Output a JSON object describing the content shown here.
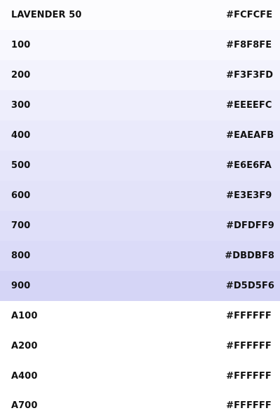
{
  "palette": {
    "swatches": [
      {
        "name": "LAVENDER 50",
        "hex": "#FCFCFE",
        "color": "#FCFCFE"
      },
      {
        "name": "100",
        "hex": "#F8F8FE",
        "color": "#F8F8FE"
      },
      {
        "name": "200",
        "hex": "#F3F3FD",
        "color": "#F3F3FD"
      },
      {
        "name": "300",
        "hex": "#EEEEFC",
        "color": "#EEEEFC"
      },
      {
        "name": "400",
        "hex": "#EAEAFB",
        "color": "#EAEAFB"
      },
      {
        "name": "500",
        "hex": "#E6E6FA",
        "color": "#E6E6FA"
      },
      {
        "name": "600",
        "hex": "#E3E3F9",
        "color": "#E3E3F9"
      },
      {
        "name": "700",
        "hex": "#DFDFF9",
        "color": "#DFDFF9"
      },
      {
        "name": "800",
        "hex": "#DBDBF8",
        "color": "#DBDBF8"
      },
      {
        "name": "900",
        "hex": "#D5D5F6",
        "color": "#D5D5F6"
      },
      {
        "name": "A100",
        "hex": "#FFFFFF",
        "color": "#FFFFFF"
      },
      {
        "name": "A200",
        "hex": "#FFFFFF",
        "color": "#FFFFFF"
      },
      {
        "name": "A400",
        "hex": "#FFFFFF",
        "color": "#FFFFFF"
      },
      {
        "name": "A700",
        "hex": "#FFFFFF",
        "color": "#FFFFFF"
      }
    ]
  }
}
